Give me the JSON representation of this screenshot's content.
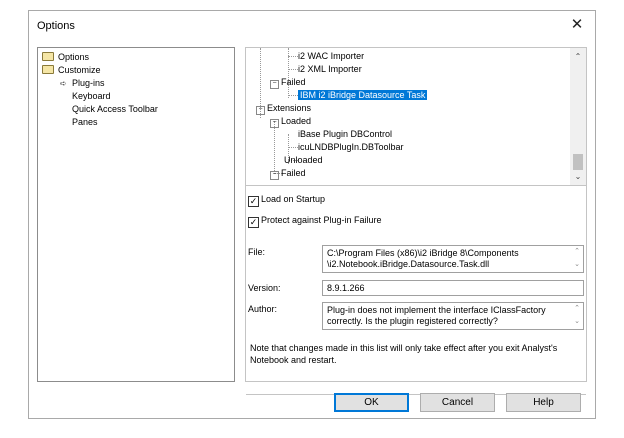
{
  "window": {
    "title": "Options",
    "close_glyph": "✕"
  },
  "nav": {
    "items": [
      {
        "label": "Options",
        "icon": "folder-icon"
      },
      {
        "label": "Customize",
        "icon": "folder-open-icon"
      },
      {
        "label": "Plug-ins",
        "icon": "arrow-icon"
      },
      {
        "label": "Keyboard"
      },
      {
        "label": "Quick Access Toolbar"
      },
      {
        "label": "Panes"
      }
    ]
  },
  "tree": {
    "items": [
      {
        "label": "i2 WAC Importer"
      },
      {
        "label": "i2 XML Importer"
      },
      {
        "label": "Failed"
      },
      {
        "label": "IBM i2 iBridge Datasource Task"
      },
      {
        "label": "Extensions"
      },
      {
        "label": "Loaded"
      },
      {
        "label": "iBase Plugin DBControl"
      },
      {
        "label": "icuLNDBPlugIn.DBToolbar"
      },
      {
        "label": "Unloaded"
      },
      {
        "label": "Failed"
      }
    ],
    "scroll_up": "⌃",
    "scroll_down": "⌄"
  },
  "options": {
    "load_on_startup": {
      "label": "Load on Startup",
      "checked": "✓"
    },
    "protect": {
      "label": "Protect against Plug-in Failure",
      "checked": "✓"
    }
  },
  "details": {
    "file_label": "File:",
    "file_line1": "C:\\Program Files (x86)\\i2 iBridge 8\\Components",
    "file_line2": "\\i2.Notebook.iBridge.Datasource.Task.dll",
    "version_label": "Version:",
    "version_value": "8.9.1.266",
    "author_label": "Author:",
    "author_line1": "Plug-in does not implement the interface IClassFactory",
    "author_line2": "correctly. Is the plugin registered correctly?"
  },
  "note": "Note that changes made in this list will only take effect after you exit Analyst's Notebook and restart.",
  "buttons": {
    "ok": "OK",
    "cancel": "Cancel",
    "help": "Help"
  }
}
